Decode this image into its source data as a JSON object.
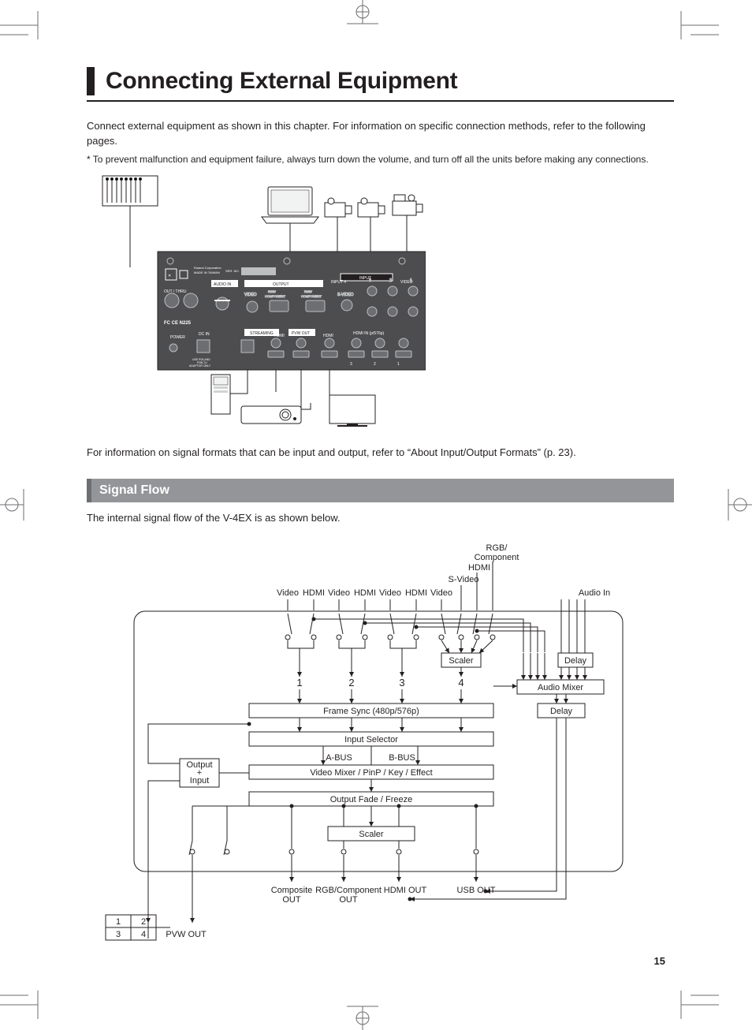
{
  "page": {
    "number": "15"
  },
  "title": "Connecting External Equipment",
  "intro": "Connect external equipment as shown in this chapter. For information on specific connection methods, refer to the following pages.",
  "footnote": "*  To prevent malfunction and equipment failure, always turn down the volume, and turn off all the units before making any connections.",
  "info2": "For information on signal formats that can be input and output, refer to “About Input/Output Formats” (p. 23).",
  "section": {
    "signal_flow": "Signal Flow"
  },
  "sub_intro": "The internal signal flow of the V-4EX is as shown below.",
  "conn_diagram": {
    "audio_in": "AUDIO IN",
    "output": "OUTPUT",
    "input": "INPUT",
    "video": "VIDEO",
    "rgb_component": "RGB/\nCOMPONENT",
    "s_video": "S-VIDEO",
    "streaming": "STREAMING",
    "hdmi": "HDMI",
    "pvw_out": "PVW OUT",
    "hdmi_in": "HDMI IN (p/576p)",
    "power": "POWER",
    "dc_in": "DC IN",
    "adaptor": "USE ROLAND\nPSB-7U\nADAPTOR ONLY",
    "out_thru": "OUT / THRU",
    "roland_corp": "Roland Corporation",
    "made_in": "MADE IN TAIWAN",
    "ser_no": "SER. NO.",
    "conformity": "FC CE  N225",
    "in": "IN",
    "n1": "1",
    "n2": "2",
    "n3": "3",
    "n4": "4"
  },
  "flow": {
    "top_labels": [
      "Video",
      "HDMI",
      "Video",
      "HDMI",
      "Video",
      "HDMI",
      "Video",
      "S-Video",
      "HDMI",
      "RGB/\nComponent",
      "Audio In"
    ],
    "scaler": "Scaler",
    "delay": "Delay",
    "audio_mixer": "Audio Mixer",
    "ch": [
      "1",
      "2",
      "3",
      "4"
    ],
    "frame_sync": "Frame Sync (480p/576p)",
    "input_selector": "Input Selector",
    "a_bus": "A-BUS",
    "b_bus": "B-BUS",
    "video_mixer": "Video Mixer / PinP / Key / Effect",
    "output_fade": "Output Fade / Freeze",
    "output_plus_input": "Output\n+\nInput",
    "outputs": {
      "pvw": "PVW OUT",
      "composite": "Composite\nOUT",
      "rgb": "RGB/Component\nOUT",
      "hdmi": "HDMI OUT",
      "usb": "USB OUT"
    },
    "grid": [
      "1",
      "2",
      "3",
      "4"
    ]
  }
}
